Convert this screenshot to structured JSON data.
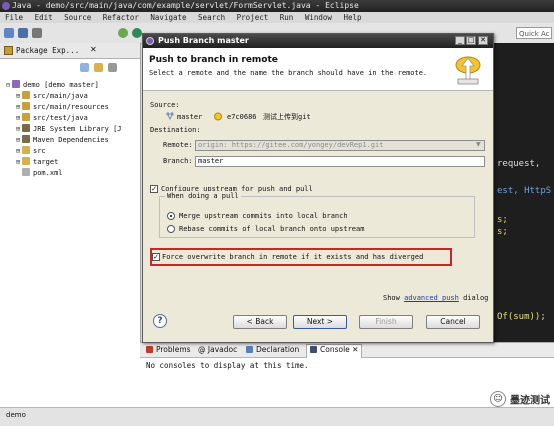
{
  "window": {
    "title": "Java - demo/src/main/java/com/example/servlet/FormServlet.java - Eclipse"
  },
  "menu": [
    "File",
    "Edit",
    "Source",
    "Refactor",
    "Navigate",
    "Search",
    "Project",
    "Run",
    "Window",
    "Help"
  ],
  "toolbar": {
    "quick_access": "Quick Ac"
  },
  "package_explorer": {
    "tab_label": "Package Exp...",
    "close": "✕",
    "tree": [
      {
        "label": "demo  [demo master]",
        "depth": 0,
        "expand": "⊟",
        "icon": "project-icon"
      },
      {
        "label": "src/main/java",
        "depth": 1,
        "expand": "⊞",
        "icon": "source-folder-icon"
      },
      {
        "label": "src/main/resources",
        "depth": 1,
        "expand": "⊞",
        "icon": "source-folder-icon"
      },
      {
        "label": "src/test/java",
        "depth": 1,
        "expand": "⊞",
        "icon": "source-folder-icon"
      },
      {
        "label": "JRE System Library [J",
        "depth": 1,
        "expand": "⊞",
        "icon": "library-icon"
      },
      {
        "label": "Maven Dependencies",
        "depth": 1,
        "expand": "⊞",
        "icon": "library-icon"
      },
      {
        "label": "src",
        "depth": 1,
        "expand": "⊞",
        "icon": "folder-icon"
      },
      {
        "label": "target",
        "depth": 1,
        "expand": "⊞",
        "icon": "folder-icon"
      },
      {
        "label": "pom.xml",
        "depth": 1,
        "expand": "",
        "icon": "xml-file-icon"
      }
    ]
  },
  "editor": {
    "lines": [
      "request,",
      "est, HttpS",
      "s;",
      "s;",
      "Of(sum));"
    ]
  },
  "dialog": {
    "title": "Push Branch master",
    "heading": "Push to branch in remote",
    "subtitle": "Select a remote and the name the branch should have in the remote.",
    "source_label": "Source:",
    "source_branch": "master",
    "source_commit": "e7c0686",
    "source_message": "测试上传到git",
    "destination_label": "Destination:",
    "remote_label": "Remote:",
    "remote_value": "origin: https://gitee.com/yongey/devRep1.git",
    "branch_label": "Branch:",
    "branch_value": "master",
    "configure_upstream": "Configure upstream for push and pull",
    "when_pull": "When doing a pull",
    "merge_option": "Merge upstream commits into local branch",
    "rebase_option": "Rebase commits of local branch onto upstream",
    "force_overwrite": "Force overwrite branch in remote if it exists and has diverged",
    "show": "Show",
    "advanced_push": "advanced push",
    "dialog_word": "dialog",
    "help": "?",
    "back": "< Back",
    "next": "Next >",
    "finish": "Finish",
    "cancel": "Cancel"
  },
  "bottom_tabs": [
    "Problems",
    "@ Javadoc",
    "Declaration",
    "Console ✕"
  ],
  "console_message": "No consoles to display at this time.",
  "status": {
    "text": "demo"
  },
  "watermark": {
    "text": "墨迹测试"
  },
  "colors": {
    "highlight": "#c62828",
    "link": "#1a3ea8",
    "editor_bg": "#1e1e1e"
  }
}
